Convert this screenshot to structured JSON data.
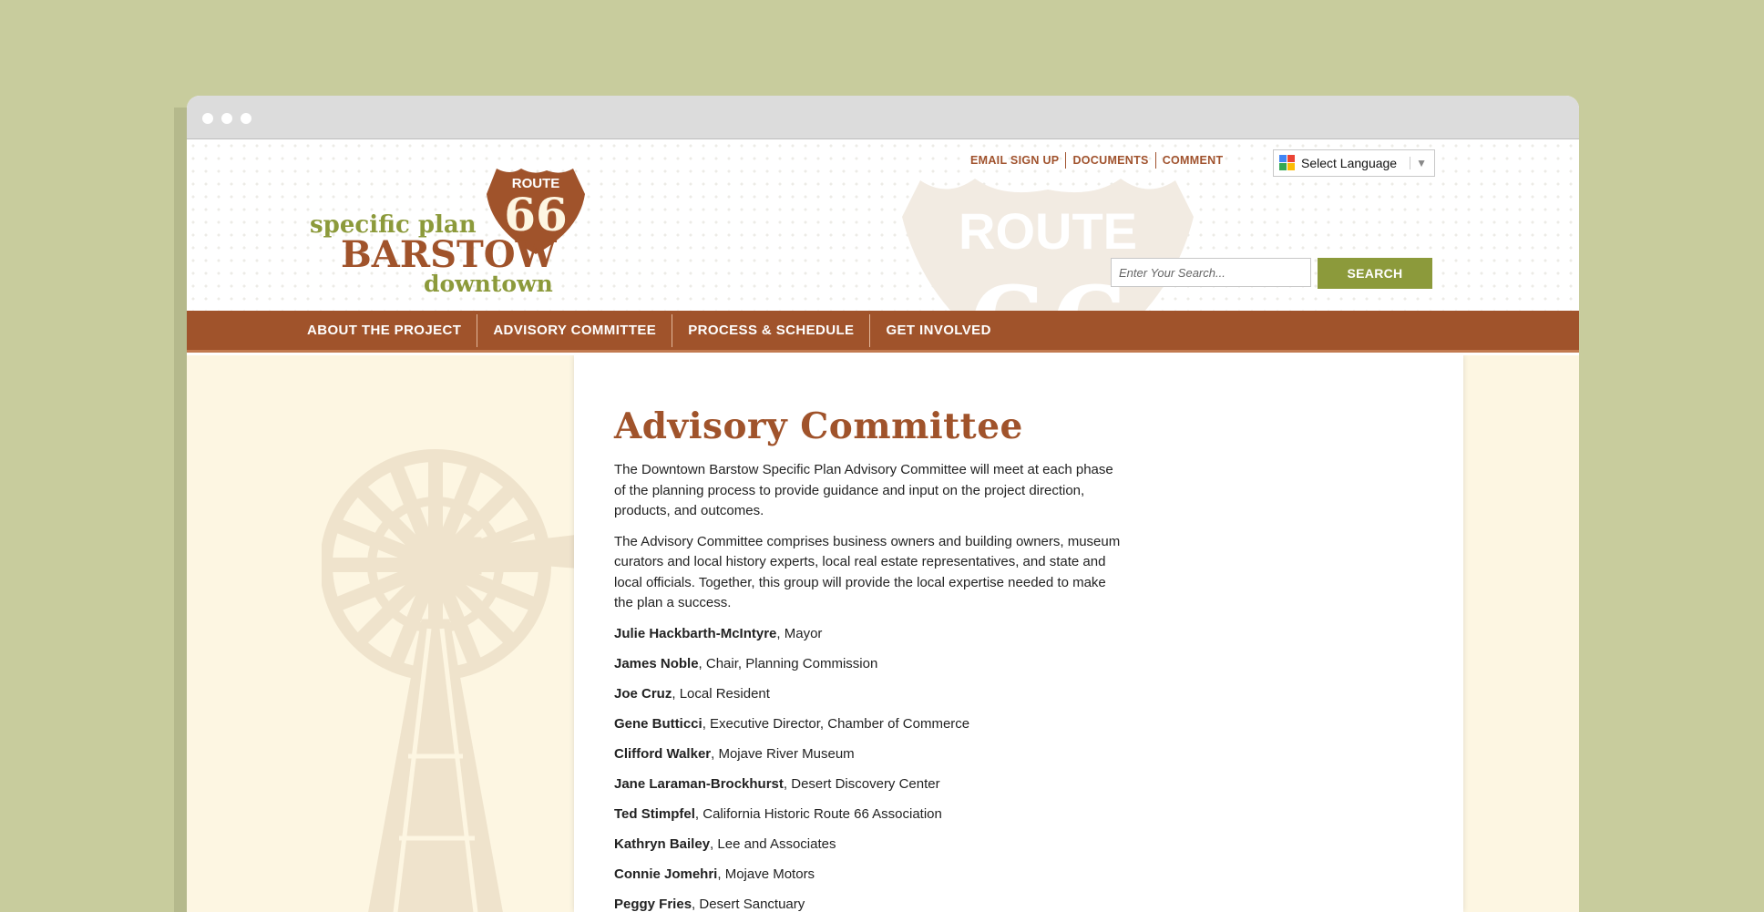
{
  "site": {
    "logo": {
      "badge_top": "ROUTE",
      "badge_number": "66",
      "line1": "specific plan",
      "line2": "BARSTOW",
      "line3": "downtown"
    },
    "watermark": {
      "text": "ROUTE",
      "number": "66"
    }
  },
  "toplinks": [
    "EMAIL SIGN UP",
    "DOCUMENTS",
    "COMMENT"
  ],
  "language": {
    "label": "Select Language",
    "icon": "google-translate-icon"
  },
  "search": {
    "placeholder": "Enter Your Search...",
    "button": "SEARCH"
  },
  "nav": [
    "ABOUT THE PROJECT",
    "ADVISORY COMMITTEE",
    "PROCESS & SCHEDULE",
    "GET INVOLVED"
  ],
  "page": {
    "title": "Advisory Committee",
    "paragraphs": [
      "The Downtown Barstow Specific Plan Advisory Committee will meet at each phase of the planning process to provide guidance and input on the project direction, products, and outcomes.",
      "The Advisory Committee comprises business owners and building owners, museum curators and local history experts, local real estate representatives, and state and local officials. Together, this group will provide the local expertise needed to make the plan a success."
    ],
    "members": [
      {
        "name": "Julie Hackbarth-McIntyre",
        "role": ", Mayor"
      },
      {
        "name": "James Noble",
        "role": ", Chair, Planning Commission"
      },
      {
        "name": "Joe Cruz",
        "role": ", Local Resident"
      },
      {
        "name": "Gene Butticci",
        "role": ", Executive Director, Chamber of Commerce"
      },
      {
        "name": "Clifford Walker",
        "role": ", Mojave River Museum"
      },
      {
        "name": "Jane Laraman-Brockhurst",
        "role": ", Desert Discovery Center"
      },
      {
        "name": "Ted Stimpfel",
        "role": ", California Historic Route 66 Association"
      },
      {
        "name": "Kathryn Bailey",
        "role": ", Lee and Associates"
      },
      {
        "name": "Connie Jomehri",
        "role": ", Mojave Motors"
      },
      {
        "name": "Peggy Fries",
        "role": ", Desert Sanctuary"
      }
    ]
  },
  "colors": {
    "brand_brown": "#a0532b",
    "brand_green": "#8c9a3b",
    "page_bg": "#c8cc9d"
  }
}
